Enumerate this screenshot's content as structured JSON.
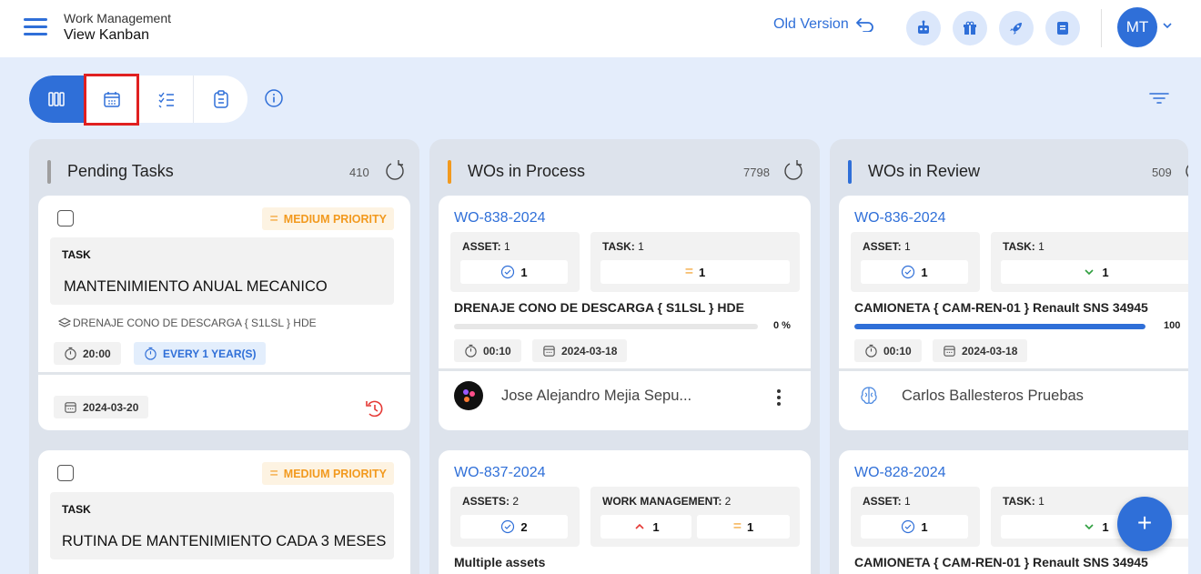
{
  "header": {
    "section": "Work Management",
    "page": "View Kanban",
    "old_version": "Old Version",
    "avatar_initials": "MT"
  },
  "colors": {
    "accent": "#2f6fd8",
    "priority_medium": "#f29a1f",
    "board_bg": "#e4edfb"
  },
  "columns": [
    {
      "title": "Pending Tasks",
      "count": "410",
      "bar_color": "#9e9e9e",
      "cards": [
        {
          "priority": "MEDIUM PRIORITY",
          "task_label": "TASK",
          "task_name": "MANTENIMIENTO ANUAL  MECANICO",
          "asset": "DRENAJE CONO DE DESCARGA { S1LSL } HDE",
          "duration": "20:00",
          "frequency": "EVERY 1 YEAR(S)",
          "date": "2024-03-20"
        },
        {
          "priority": "MEDIUM PRIORITY",
          "task_label": "TASK",
          "task_name": "RUTINA DE MANTENIMIENTO CADA 3 MESES"
        }
      ]
    },
    {
      "title": "WOs in Process",
      "count": "7798",
      "bar_color": "#f29a1f",
      "cards": [
        {
          "wo": "WO-838-2024",
          "asset_label": "ASSET:",
          "asset_count": "1",
          "asset_done": "1",
          "task_label": "TASK:",
          "task_count": "1",
          "task_medium": "1",
          "description": "DRENAJE CONO DE DESCARGA { S1LSL } HDE",
          "progress": 0,
          "progress_text": "0 %",
          "duration": "00:10",
          "date": "2024-03-18",
          "assignee": "Jose Alejandro Mejia Sepu..."
        },
        {
          "wo": "WO-837-2024",
          "asset_label": "ASSETS:",
          "asset_count": "2",
          "asset_done": "2",
          "task_label": "WORK MANAGEMENT:",
          "task_count": "2",
          "task_high": "1",
          "task_medium": "1",
          "description": "Multiple assets"
        }
      ]
    },
    {
      "title": "WOs in Review",
      "count": "509",
      "bar_color": "#2f6fd8",
      "cards": [
        {
          "wo": "WO-836-2024",
          "asset_label": "ASSET:",
          "asset_count": "1",
          "asset_done": "1",
          "task_label": "TASK:",
          "task_count": "1",
          "task_low": "1",
          "description": "CAMIONETA { CAM-REN-01 } Renault SNS 34945",
          "progress": 100,
          "progress_text": "100",
          "duration": "00:10",
          "date": "2024-03-18",
          "assignee": "Carlos Ballesteros Pruebas"
        },
        {
          "wo": "WO-828-2024",
          "asset_label": "ASSET:",
          "asset_count": "1",
          "asset_done": "1",
          "task_label": "TASK:",
          "task_count": "1",
          "task_low": "1",
          "description": "CAMIONETA { CAM-REN-01 } Renault SNS 34945"
        }
      ]
    }
  ],
  "fab_label": "+"
}
